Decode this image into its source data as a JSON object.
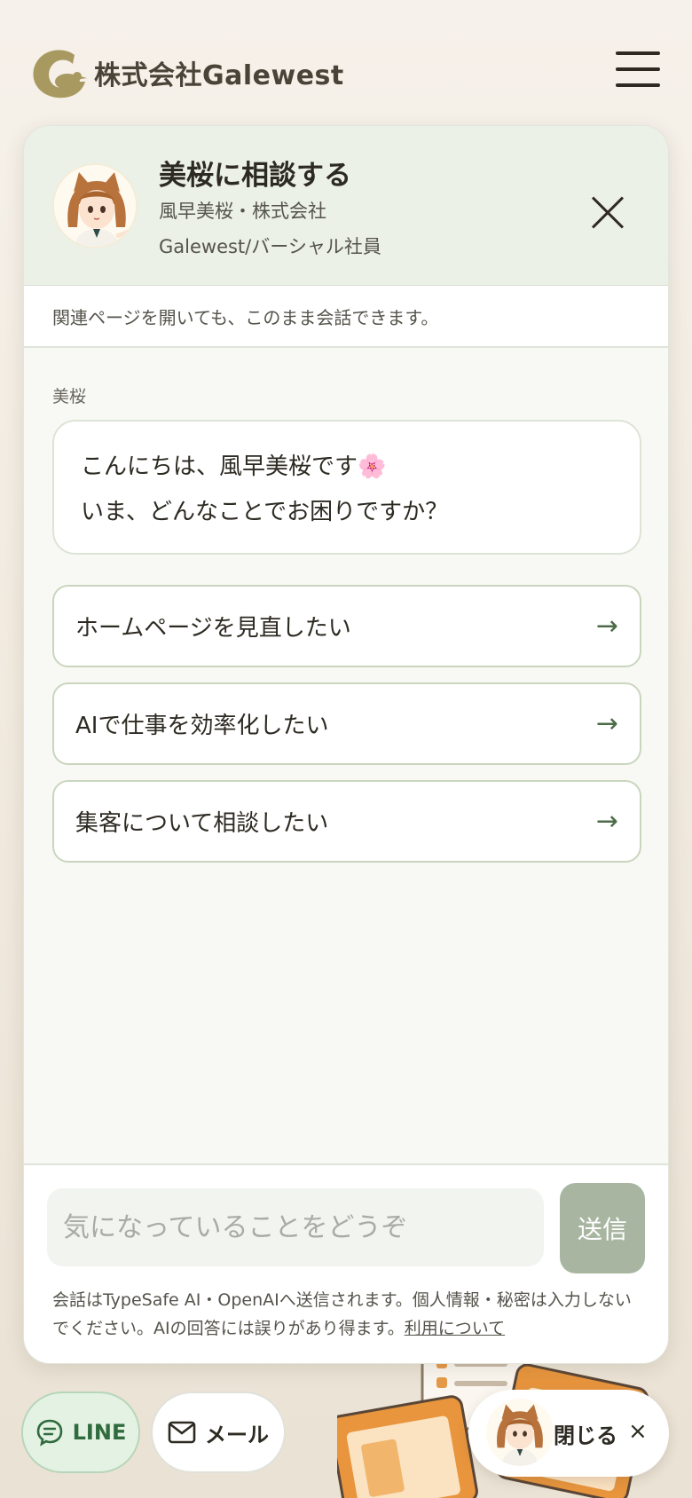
{
  "site": {
    "company_name": "株式会社Galewest",
    "brand_color": "#a89960"
  },
  "chat": {
    "title": "美桜に相談する",
    "subtitle_line1": "風早美桜・株式会社",
    "subtitle_line2": "Galewest/バーシャル社員",
    "notice": "関連ページを開いても、このまま会話できます。",
    "sender": "美桜",
    "greeting_line1": "こんにちは、風早美桜です🌸",
    "greeting_line2": "いま、どんなことでお困りですか？",
    "suggestions": [
      {
        "label": "ホームページを見直したい",
        "arrow": "→"
      },
      {
        "label": "AIで仕事を効率化したい",
        "arrow": "→"
      },
      {
        "label": "集客について相談したい",
        "arrow": "→"
      }
    ],
    "input_placeholder": "気になっていることをどうぞ",
    "send_label": "送信",
    "disclaimer": "会話はTypeSafe AI・OpenAIへ送信されます。個人情報・秘密は入力しないでください。AIの回答には誤りがあり得ます。",
    "disclaimer_link": "利用について"
  },
  "footer_buttons": {
    "line_label": "LINE",
    "mail_label": "メール",
    "close_label": "閉じる",
    "close_icon": "×"
  },
  "colors": {
    "header_bg": "#ebf1e6",
    "send_bg": "#a8b6a1",
    "line_bg": "#e4f2e4",
    "accent_green": "#4d6b48"
  }
}
